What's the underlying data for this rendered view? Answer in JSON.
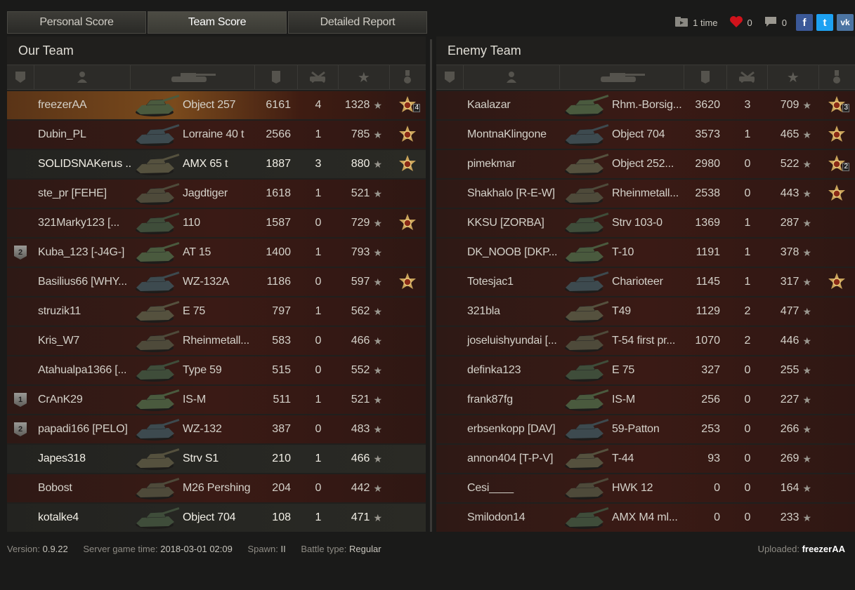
{
  "tabs": [
    "Personal Score",
    "Team Score",
    "Detailed Report"
  ],
  "active_tab": 1,
  "share": {
    "views": "1 time",
    "likes": "0",
    "comments": "0"
  },
  "our_team": {
    "title": "Our Team",
    "rows": [
      {
        "name": "freezerAA",
        "tank": "Object 257",
        "xp": "6161",
        "kills": "4",
        "dmg": "1328",
        "medal": "4",
        "rank": "",
        "state": "me"
      },
      {
        "name": "Dubin_PL",
        "tank": "Lorraine 40 t",
        "xp": "2566",
        "kills": "1",
        "dmg": "785",
        "medal": "1",
        "rank": "",
        "state": "dead"
      },
      {
        "name": "SOLIDSNAKerus ...",
        "tank": "AMX 65 t",
        "xp": "1887",
        "kills": "3",
        "dmg": "880",
        "medal": "1",
        "rank": "",
        "state": "alive"
      },
      {
        "name": "ste_pr [FEHE]",
        "tank": "Jagdtiger",
        "xp": "1618",
        "kills": "1",
        "dmg": "521",
        "medal": "",
        "rank": "",
        "state": "dead"
      },
      {
        "name": "321Marky123 [...",
        "tank": "110",
        "xp": "1587",
        "kills": "0",
        "dmg": "729",
        "medal": "1",
        "rank": "",
        "state": "dead"
      },
      {
        "name": "Kuba_123 [-J4G-]",
        "tank": "AT 15",
        "xp": "1400",
        "kills": "1",
        "dmg": "793",
        "medal": "",
        "rank": "2",
        "state": "dead"
      },
      {
        "name": "Basilius66 [WHY...",
        "tank": "WZ-132A",
        "xp": "1186",
        "kills": "0",
        "dmg": "597",
        "medal": "1",
        "rank": "",
        "state": "dead"
      },
      {
        "name": "struzik11",
        "tank": "E 75",
        "xp": "797",
        "kills": "1",
        "dmg": "562",
        "medal": "",
        "rank": "",
        "state": "dead"
      },
      {
        "name": "Kris_W7",
        "tank": "Rheinmetall...",
        "xp": "583",
        "kills": "0",
        "dmg": "466",
        "medal": "",
        "rank": "",
        "state": "dead"
      },
      {
        "name": "Atahualpa1366 [...",
        "tank": "Type 59",
        "xp": "515",
        "kills": "0",
        "dmg": "552",
        "medal": "",
        "rank": "",
        "state": "dead"
      },
      {
        "name": "CrAnK29",
        "tank": "IS-M",
        "xp": "511",
        "kills": "1",
        "dmg": "521",
        "medal": "",
        "rank": "1",
        "state": "dead"
      },
      {
        "name": "papadi166 [PELO]",
        "tank": "WZ-132",
        "xp": "387",
        "kills": "0",
        "dmg": "483",
        "medal": "",
        "rank": "2",
        "state": "dead"
      },
      {
        "name": "Japes318",
        "tank": "Strv S1",
        "xp": "210",
        "kills": "1",
        "dmg": "466",
        "medal": "",
        "rank": "",
        "state": "alive"
      },
      {
        "name": "Bobost",
        "tank": "M26 Pershing",
        "xp": "204",
        "kills": "0",
        "dmg": "442",
        "medal": "",
        "rank": "",
        "state": "dead"
      },
      {
        "name": "kotalke4",
        "tank": "Object 704",
        "xp": "108",
        "kills": "1",
        "dmg": "471",
        "medal": "",
        "rank": "",
        "state": "alive"
      }
    ]
  },
  "enemy_team": {
    "title": "Enemy Team",
    "rows": [
      {
        "name": "Kaalazar",
        "tank": "Rhm.-Borsig...",
        "xp": "3620",
        "kills": "3",
        "dmg": "709",
        "medal": "3",
        "rank": "",
        "state": "dead"
      },
      {
        "name": "MontnaKlingone",
        "tank": "Object 704",
        "xp": "3573",
        "kills": "1",
        "dmg": "465",
        "medal": "1",
        "rank": "",
        "state": "dead"
      },
      {
        "name": "pimekmar",
        "tank": "Object 252...",
        "xp": "2980",
        "kills": "0",
        "dmg": "522",
        "medal": "2",
        "rank": "",
        "state": "dead"
      },
      {
        "name": "Shakhalo [R-E-W]",
        "tank": "Rheinmetall...",
        "xp": "2538",
        "kills": "0",
        "dmg": "443",
        "medal": "1",
        "rank": "",
        "state": "dead"
      },
      {
        "name": "KKSU [ZORBA]",
        "tank": "Strv 103-0",
        "xp": "1369",
        "kills": "1",
        "dmg": "287",
        "medal": "",
        "rank": "",
        "state": "dead"
      },
      {
        "name": "DK_NOOB [DKP...",
        "tank": "T-10",
        "xp": "1191",
        "kills": "1",
        "dmg": "378",
        "medal": "",
        "rank": "",
        "state": "dead"
      },
      {
        "name": "Totesjac1",
        "tank": "Charioteer",
        "xp": "1145",
        "kills": "1",
        "dmg": "317",
        "medal": "1",
        "rank": "",
        "state": "dead"
      },
      {
        "name": "321bla",
        "tank": "T49",
        "xp": "1129",
        "kills": "2",
        "dmg": "477",
        "medal": "",
        "rank": "",
        "state": "dead"
      },
      {
        "name": "joseluishyundai [...",
        "tank": "T-54 first pr...",
        "xp": "1070",
        "kills": "2",
        "dmg": "446",
        "medal": "",
        "rank": "",
        "state": "dead"
      },
      {
        "name": "definka123",
        "tank": "E 75",
        "xp": "327",
        "kills": "0",
        "dmg": "255",
        "medal": "",
        "rank": "",
        "state": "dead"
      },
      {
        "name": "frank87fg",
        "tank": "IS-M",
        "xp": "256",
        "kills": "0",
        "dmg": "227",
        "medal": "",
        "rank": "",
        "state": "dead"
      },
      {
        "name": "erbsenkopp [DAV]",
        "tank": "59-Patton",
        "xp": "253",
        "kills": "0",
        "dmg": "266",
        "medal": "",
        "rank": "",
        "state": "dead"
      },
      {
        "name": "annon404 [T-P-V]",
        "tank": "T-44",
        "xp": "93",
        "kills": "0",
        "dmg": "269",
        "medal": "",
        "rank": "",
        "state": "dead"
      },
      {
        "name": "Cesi____",
        "tank": "HWK 12",
        "xp": "0",
        "kills": "0",
        "dmg": "164",
        "medal": "",
        "rank": "",
        "state": "dead"
      },
      {
        "name": "Smilodon14",
        "tank": "AMX M4 ml...",
        "xp": "0",
        "kills": "0",
        "dmg": "233",
        "medal": "",
        "rank": "",
        "state": "dead"
      }
    ]
  },
  "footer": {
    "version_label": "Version:",
    "version": "0.9.22",
    "time_label": "Server game time:",
    "time": "2018-03-01 02:09",
    "spawn_label": "Spawn:",
    "spawn": "II",
    "battle_label": "Battle type:",
    "battle": "Regular",
    "uploaded_label": "Uploaded:",
    "uploaded": "freezerAA"
  }
}
